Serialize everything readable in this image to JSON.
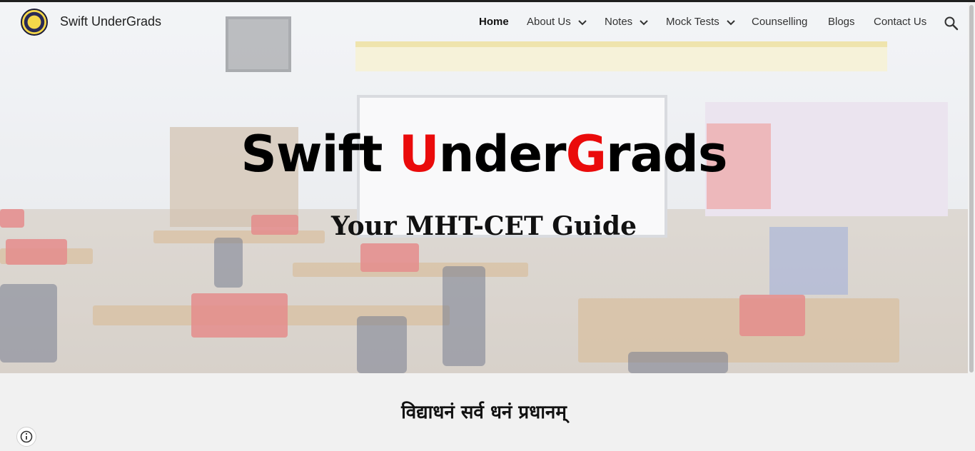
{
  "site": {
    "name": "Swift UnderGrads"
  },
  "nav": {
    "items": [
      {
        "label": "Home",
        "active": true,
        "has_dropdown": false
      },
      {
        "label": "About Us",
        "active": false,
        "has_dropdown": true
      },
      {
        "label": "Notes",
        "active": false,
        "has_dropdown": true
      },
      {
        "label": "Mock Tests",
        "active": false,
        "has_dropdown": true
      },
      {
        "label": "Counselling",
        "active": false,
        "has_dropdown": false
      },
      {
        "label": "Blogs",
        "active": false,
        "has_dropdown": false
      },
      {
        "label": "Contact Us",
        "active": false,
        "has_dropdown": false
      }
    ],
    "search_icon": "search-icon"
  },
  "hero": {
    "title_parts": [
      "Swift ",
      "U",
      "nder",
      "G",
      "rads"
    ],
    "subtitle": "Your MHT-CET Guide",
    "accent_color": "#ea0b0b"
  },
  "section": {
    "motto": "विद्याधनं सर्व धनं प्रधानम्"
  },
  "footer": {
    "info_icon": "info-icon"
  }
}
